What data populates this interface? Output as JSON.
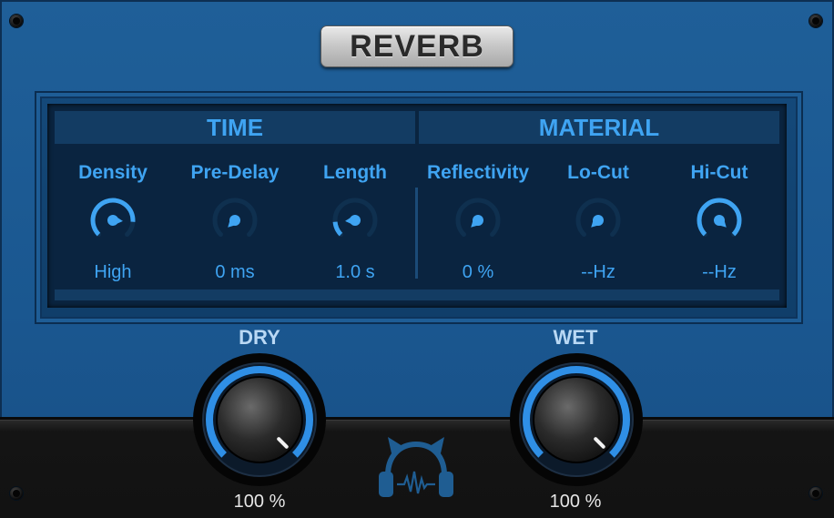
{
  "title": "REVERB",
  "sections": {
    "time": "TIME",
    "material": "MATERIAL"
  },
  "knobs": {
    "density": {
      "label": "Density",
      "value": "High",
      "level": 0.85
    },
    "pre_delay": {
      "label": "Pre-Delay",
      "value": "0 ms",
      "level": 0.0
    },
    "length": {
      "label": "Length",
      "value": "1.0 s",
      "level": 0.15
    },
    "reflectivity": {
      "label": "Reflectivity",
      "value": "0 %",
      "level": 0.0
    },
    "lo_cut": {
      "label": "Lo-Cut",
      "value": "--Hz",
      "level": 0.0
    },
    "hi_cut": {
      "label": "Hi-Cut",
      "value": "--Hz",
      "level": 1.0
    }
  },
  "dry": {
    "label": "DRY",
    "value": "100 %",
    "level": 1.0
  },
  "wet": {
    "label": "WET",
    "value": "100 %",
    "level": 1.0
  },
  "colors": {
    "accent": "#3fa4f2",
    "panel": "#1a5790",
    "display": "#0a2440",
    "base": "#141414"
  },
  "icons": {
    "logo": "cat-headphones-icon"
  }
}
